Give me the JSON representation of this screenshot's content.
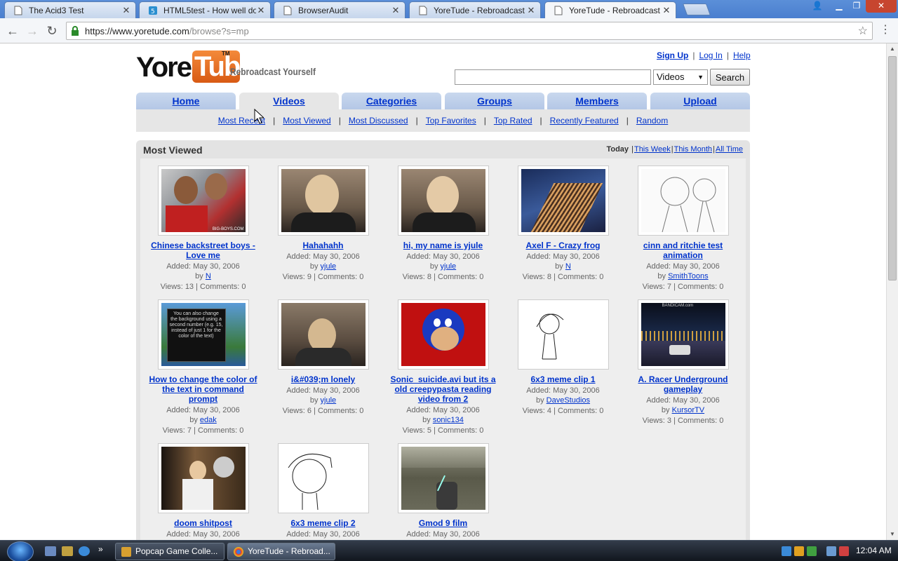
{
  "browser": {
    "tabs": [
      {
        "title": "The Acid3 Test",
        "close": "✕"
      },
      {
        "title": "HTML5test - How well do",
        "close": "✕"
      },
      {
        "title": "BrowserAudit",
        "close": "✕"
      },
      {
        "title": "YoreTude - Rebroadcast",
        "close": "✕"
      },
      {
        "title": "YoreTude - Rebroadcast",
        "close": "✕"
      }
    ],
    "window_controls": {
      "user": "👤",
      "minimize": "▁",
      "maximize": "❐",
      "close": "✕"
    },
    "address": {
      "scheme_host": "https://www.yoretude.com",
      "path": "/browse?s=mp"
    },
    "nav": {
      "back": "←",
      "forward": "→",
      "reload": "↻",
      "star": "☆",
      "menu": "⋮"
    }
  },
  "site": {
    "logo": {
      "yore": "Yore",
      "tube": "Tube",
      "tm": "TM",
      "slogan": "Rebroadcast Yourself"
    },
    "user_links": {
      "sign_up": "Sign Up",
      "log_in": "Log In",
      "help": "Help",
      "sep": "|"
    },
    "search": {
      "value": "",
      "category": "Videos",
      "button": "Search",
      "arrow": "▼"
    },
    "nav_tabs": [
      "Home",
      "Videos",
      "Categories",
      "Groups",
      "Members",
      "Upload"
    ],
    "sub_nav": [
      "Most Recent",
      "Most Viewed",
      "Most Discussed",
      "Top Favorites",
      "Top Rated",
      "Recently Featured",
      "Random"
    ],
    "sub_nav_sep": "|",
    "section_title": "Most Viewed",
    "range": {
      "today": "Today",
      "week": "This Week",
      "month": "This Month",
      "all": "All Time",
      "sep": "|"
    },
    "videos": [
      {
        "title": "Chinese backstreet boys - Love me",
        "added": "Added: May 30, 2006",
        "by": "by",
        "user": "N",
        "stats": "Views: 13 | Comments: 0",
        "watermark": "BIG-BOYS.COM"
      },
      {
        "title": "Hahahahh",
        "added": "Added: May 30, 2006",
        "by": "by",
        "user": "yjule",
        "stats": "Views: 9 | Comments: 0"
      },
      {
        "title": "hi, my name is yjule",
        "added": "Added: May 30, 2006",
        "by": "by",
        "user": "yjule",
        "stats": "Views: 8 | Comments: 0"
      },
      {
        "title": "Axel F - Crazy frog",
        "added": "Added: May 30, 2006",
        "by": "by",
        "user": "N",
        "stats": "Views: 8 | Comments: 0"
      },
      {
        "title": "cinn and ritchie test animation",
        "added": "Added: May 30, 2006",
        "by": "by",
        "user": "SmithToons",
        "stats": "Views: 7 | Comments: 0"
      },
      {
        "title": "How to change the color of the text in command prompt",
        "added": "Added: May 30, 2006",
        "by": "by",
        "user": "edak",
        "stats": "Views: 7 | Comments: 0",
        "caption": "You can also change the background using a second number (e.g. 15, instead of just 1 for the color of the text)"
      },
      {
        "title": "i&#039;m lonely",
        "added": "Added: May 30, 2006",
        "by": "by",
        "user": "yjule",
        "stats": "Views: 6 | Comments: 0"
      },
      {
        "title": "Sonic_suicide.avi but its a old creepypasta reading video from 2",
        "added": "Added: May 30, 2006",
        "by": "by",
        "user": "sonic134",
        "stats": "Views: 5 | Comments: 0"
      },
      {
        "title": "6x3 meme clip 1",
        "added": "Added: May 30, 2006",
        "by": "by",
        "user": "DaveStudios",
        "stats": "Views: 4 | Comments: 0"
      },
      {
        "title": "A. Racer Underground gameplay",
        "added": "Added: May 30, 2006",
        "by": "by",
        "user": "KursorTV",
        "stats": "Views: 3 | Comments: 0",
        "watermark": "BANDICAM.com"
      },
      {
        "title": "doom shitpost",
        "added": "Added: May 30, 2006"
      },
      {
        "title": "6x3 meme clip 2",
        "added": "Added: May 30, 2006"
      },
      {
        "title": "Gmod 9 film",
        "added": "Added: May 30, 2006"
      }
    ]
  },
  "taskbar": {
    "buttons": [
      {
        "label": "Popcap Game Colle..."
      },
      {
        "label": "YoreTude - Rebroad..."
      }
    ],
    "quick_launch_more": "»",
    "clock": "12:04 AM"
  },
  "colors": {
    "link": "#0033cc",
    "logo_orange": "#e8701f",
    "tab_blue": "#b8cae8",
    "panel_gray": "#e3e3e3"
  }
}
